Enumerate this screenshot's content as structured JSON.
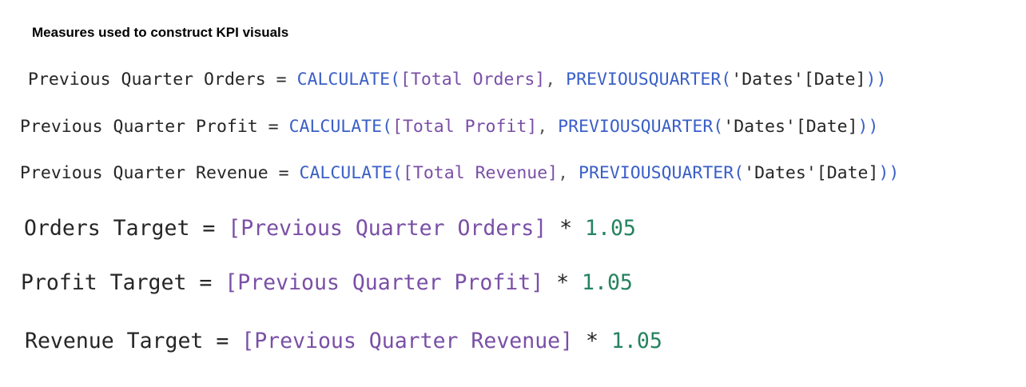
{
  "heading": "Measures used to construct KPI visuals",
  "colors": {
    "function": "#3a5fc7",
    "measure_ref": "#7a4fa6",
    "number": "#25835f",
    "text": "#262626"
  },
  "lines": [
    {
      "name": "Previous Quarter Orders",
      "eq": " = ",
      "fn": "CALCULATE",
      "open": "(",
      "measure": "[Total Orders]",
      "comma": ", ",
      "fn2": "PREVIOUSQUARTER",
      "open2": "(",
      "table": "'Dates'",
      "column": "[Date]",
      "close": "))"
    },
    {
      "name": "Previous Quarter Profit",
      "eq": " = ",
      "fn": "CALCULATE",
      "open": "(",
      "measure": "[Total Profit]",
      "comma": ", ",
      "fn2": "PREVIOUSQUARTER",
      "open2": "(",
      "table": "'Dates'",
      "column": "[Date]",
      "close": "))"
    },
    {
      "name": "Previous Quarter Revenue",
      "eq": " = ",
      "fn": "CALCULATE",
      "open": "(",
      "measure": "[Total Revenue]",
      "comma": ", ",
      "fn2": "PREVIOUSQUARTER",
      "open2": "(",
      "table": "'Dates'",
      "column": "[Date]",
      "close": "))"
    },
    {
      "name": "Orders Target",
      "eq": " = ",
      "measure": "[Previous Quarter Orders]",
      "op": " * ",
      "number": "1.05"
    },
    {
      "name": "Profit Target",
      "eq": " = ",
      "measure": "[Previous Quarter Profit]",
      "op": " * ",
      "number": "1.05"
    },
    {
      "name": "Revenue Target",
      "eq": " = ",
      "measure": "[Previous Quarter Revenue]",
      "op": " * ",
      "number": "1.05"
    }
  ]
}
